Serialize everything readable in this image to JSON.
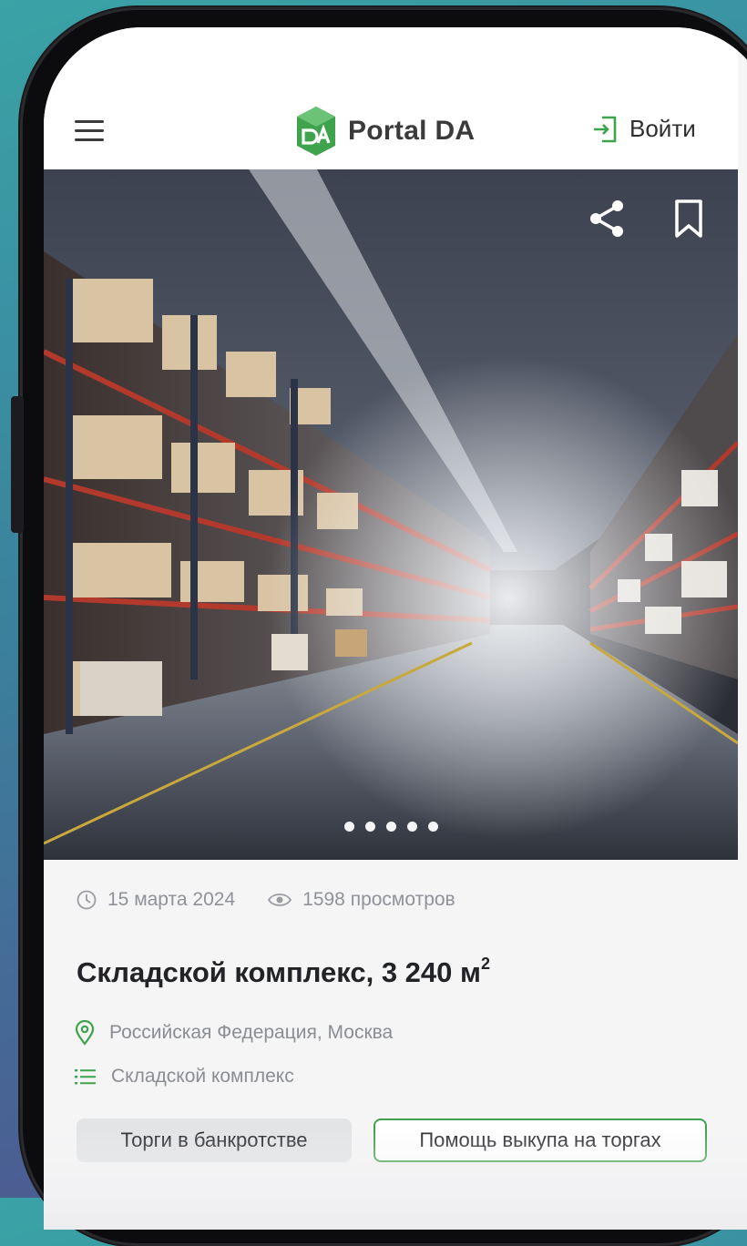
{
  "header": {
    "brand": "Portal DA",
    "login_label": "Войти"
  },
  "gallery": {
    "slides": 5,
    "active_slide": 1
  },
  "listing": {
    "date": "15 марта 2024",
    "views": "1598 просмотров",
    "title": "Складской комплекс, 3 240 м",
    "title_superscript": "2",
    "location": "Российская Федерация, Москва",
    "category": "Складской комплекс",
    "tags": [
      "Торги в банкротстве",
      "Помощь выкупа на торгах"
    ]
  },
  "colors": {
    "brand_green": "#3fa34d",
    "text_dark": "#222326",
    "text_muted": "#8a8d93",
    "background": "#f5f5f6"
  },
  "icons": [
    "menu-icon",
    "logo-mark",
    "login-icon",
    "share-icon",
    "bookmark-icon",
    "clock-icon",
    "eye-icon",
    "location-pin-icon",
    "list-icon"
  ]
}
